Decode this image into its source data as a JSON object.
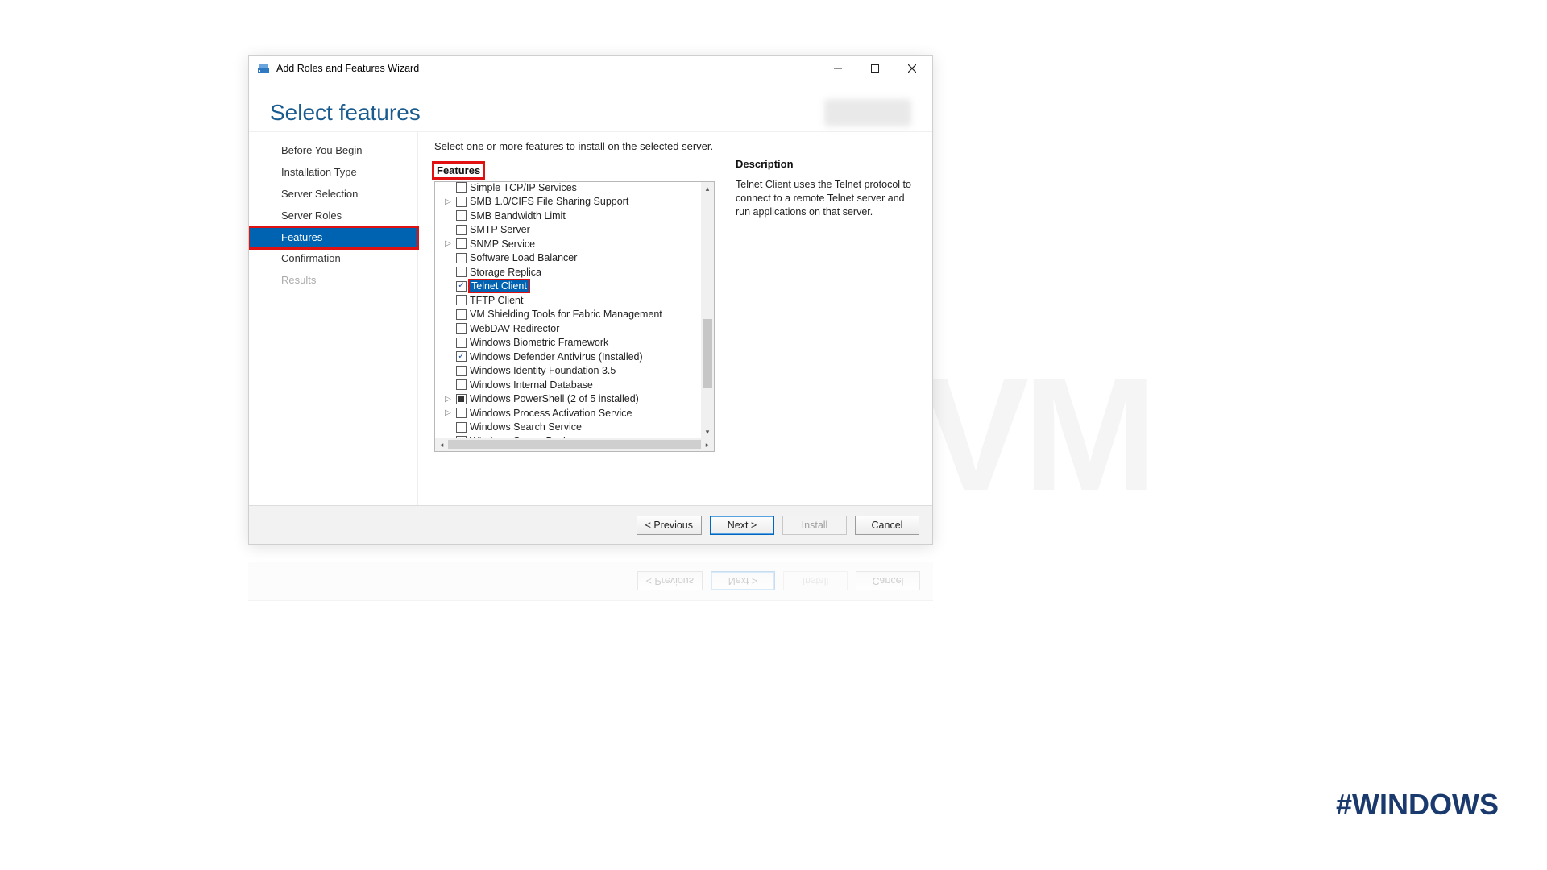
{
  "window": {
    "title": "Add Roles and Features Wizard",
    "page_heading": "Select features"
  },
  "sidebar": {
    "steps": [
      {
        "label": "Before You Begin"
      },
      {
        "label": "Installation Type"
      },
      {
        "label": "Server Selection"
      },
      {
        "label": "Server Roles"
      },
      {
        "label": "Features",
        "current": true,
        "highlighted": true
      },
      {
        "label": "Confirmation"
      },
      {
        "label": "Results",
        "disabled": true
      }
    ]
  },
  "main": {
    "intro": "Select one or more features to install on the selected server.",
    "features_label": "Features",
    "features_label_highlighted": true,
    "description_label": "Description",
    "description_text": "Telnet Client uses the Telnet protocol to connect to a remote Telnet server and run applications on that server."
  },
  "features": [
    {
      "label": "Simple TCP/IP Services",
      "checked": false
    },
    {
      "label": "SMB 1.0/CIFS File Sharing Support",
      "checked": false,
      "expander": true
    },
    {
      "label": "SMB Bandwidth Limit",
      "checked": false
    },
    {
      "label": "SMTP Server",
      "checked": false
    },
    {
      "label": "SNMP Service",
      "checked": false,
      "expander": true
    },
    {
      "label": "Software Load Balancer",
      "checked": false
    },
    {
      "label": "Storage Replica",
      "checked": false
    },
    {
      "label": "Telnet Client",
      "checked": true,
      "selected": true,
      "highlighted": true
    },
    {
      "label": "TFTP Client",
      "checked": false
    },
    {
      "label": "VM Shielding Tools for Fabric Management",
      "checked": false
    },
    {
      "label": "WebDAV Redirector",
      "checked": false
    },
    {
      "label": "Windows Biometric Framework",
      "checked": false
    },
    {
      "label": "Windows Defender Antivirus (Installed)",
      "checked": true
    },
    {
      "label": "Windows Identity Foundation 3.5",
      "checked": false
    },
    {
      "label": "Windows Internal Database",
      "checked": false
    },
    {
      "label": "Windows PowerShell (2 of 5 installed)",
      "indeterminate": true,
      "expander": true
    },
    {
      "label": "Windows Process Activation Service",
      "checked": false,
      "expander": true
    },
    {
      "label": "Windows Search Service",
      "checked": false
    },
    {
      "label": "Windows Server Backup",
      "checked": false
    }
  ],
  "footer": {
    "previous": "< Previous",
    "next": "Next >",
    "install": "Install",
    "cancel": "Cancel"
  },
  "page": {
    "watermark": "NeuronVM",
    "hashtag": "#WINDOWS"
  }
}
